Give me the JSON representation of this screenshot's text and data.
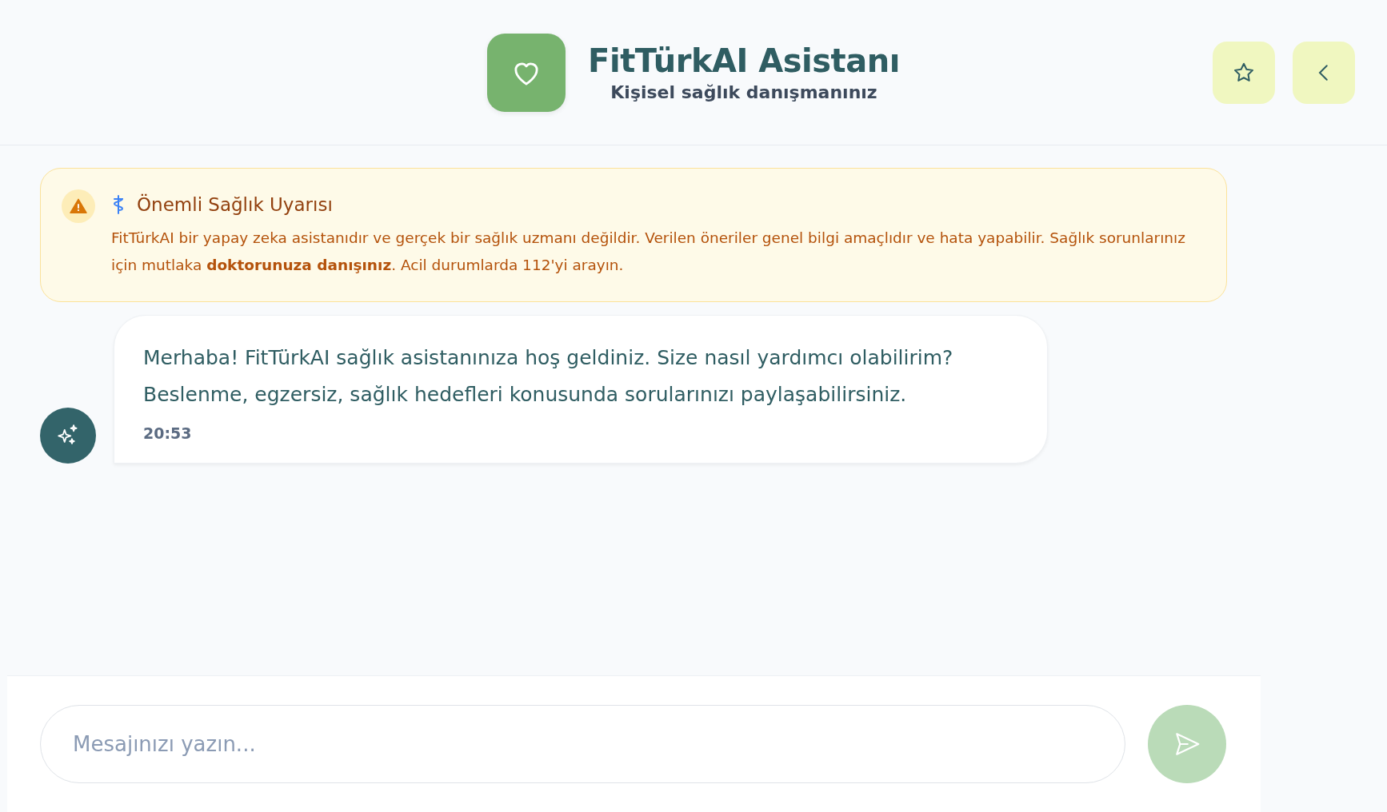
{
  "header": {
    "title": "FitTürkAI Asistanı",
    "subtitle": "Kişisel sağlık danışmanınız"
  },
  "warning": {
    "title": "Önemli Sağlık Uyarısı",
    "text": "FitTürkAI bir yapay zeka asistanıdır ve gerçek bir sağlık uzmanı değildir. Verilen öneriler genel bilgi amaçlıdır ve hata yapabilir. Sağlık sorunlarınız için mutlaka **doktorunuza danışınız**. Acil durumlarda 112'yi arayın."
  },
  "messages": [
    {
      "kind": "assistant",
      "text": "Merhaba! FitTürkAI sağlık asistanınıza hoş geldiniz. Size nasıl yardımcı olabilirim? Beslenme, egzersiz, sağlık hedefleri konusunda sorularınızı paylaşabilirsiniz.",
      "time": "20:53"
    }
  ],
  "composer": {
    "placeholder": "Mesajınızı yazın...",
    "send_disabled": true
  }
}
